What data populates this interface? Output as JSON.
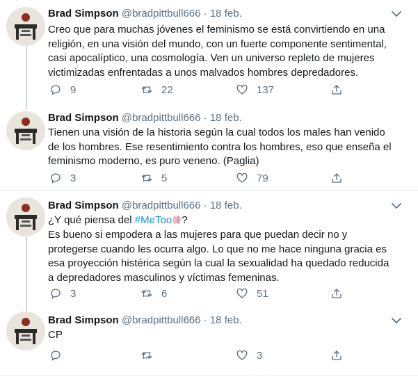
{
  "tweets": [
    {
      "name": "Brad Simpson",
      "handle": "@bradpittbull666",
      "separator": "·",
      "date": "18 feb.",
      "text": "Creo que para muchas jóvenes el feminismo se está convirtiendo en una\nreligión, en una visión del mundo, con un fuerte componente sentimental,\ncasi apocalíptico, una cosmología. Ven un universo repleto de mujeres\nvictimizadas enfrentadas a unos malvados hombres depredadores.",
      "replies": "9",
      "retweets": "22",
      "likes": "137"
    },
    {
      "name": "Brad Simpson",
      "handle": "@bradpittbull666",
      "separator": "·",
      "date": "18 feb.",
      "text": "Tienen una visión de la historia según la cual todos los males han venido\nde los hombres.  Ese resentimiento contra los hombres, eso que enseña el\nfeminismo moderno, es puro veneno. (Paglia)",
      "replies": "3",
      "retweets": "5",
      "likes": "79"
    },
    {
      "name": "Brad Simpson",
      "handle": "@bradpittbull666",
      "separator": "·",
      "date": "18 feb.",
      "text_prefix": "¿Y qué piensa del ",
      "hashtag": "#MeToo",
      "text_suffix": "?",
      "text": "Es bueno si empodera a las mujeres para que puedan decir no y\nprotegerse cuando les ocurra algo. Lo que no me hace ninguna gracia es\nesa proyección histérica según la cual la sexualidad ha quedado reducida\na depredadores masculinos y víctimas femeninas.",
      "replies": "3",
      "retweets": "6",
      "likes": "51"
    },
    {
      "name": "Brad Simpson",
      "handle": "@bradpittbull666",
      "separator": "·",
      "date": "18 feb.",
      "text": "CP",
      "replies": "",
      "retweets": "",
      "likes": "3"
    }
  ],
  "icons": {
    "reply": "reply-icon",
    "retweet": "retweet-icon",
    "like": "heart-icon",
    "share": "share-icon",
    "more": "chevron-down-icon"
  },
  "colors": {
    "text": "#14171a",
    "muted": "#5b7083",
    "link": "#1b95e0",
    "thread_line": "#cfd9de",
    "divider": "#e6ecf0"
  }
}
